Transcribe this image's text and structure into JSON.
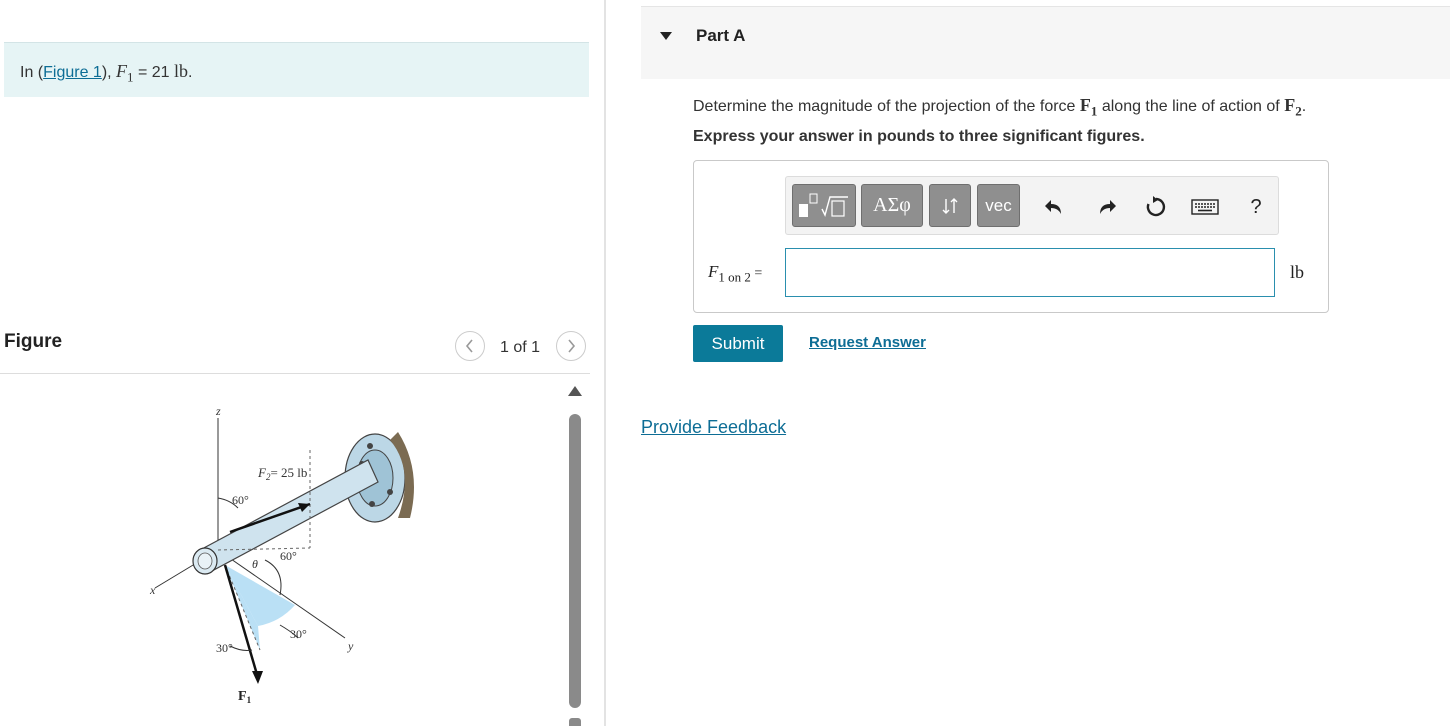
{
  "intro": {
    "prefix": "In (",
    "figure_link": "Figure 1",
    "suffix_1": "), ",
    "force_symbol": "F",
    "force_sub": "1",
    "equals": " = 21 ",
    "unit": "lb",
    "period": "."
  },
  "figure_panel": {
    "title": "Figure",
    "pager": "1 of 1",
    "labels": {
      "z": "z",
      "x": "x",
      "y": "y",
      "f2": "F",
      "f2_sub": "2",
      "f2_value": "= 25 lb",
      "angle_60a": "60°",
      "angle_60b": "60°",
      "theta": "θ",
      "angle_30a": "30°",
      "angle_30b": "30°",
      "f1": "F",
      "f1_sub": "1"
    }
  },
  "part_a": {
    "title": "Part A",
    "question_prefix": "Determine the magnitude of the projection of the force ",
    "q_f1": "F",
    "q_f1_sub": "1",
    "question_mid": " along the line of action of ",
    "q_f2": "F",
    "q_f2_sub": "2",
    "question_end": ".",
    "instruction": "Express your answer in pounds to three significant figures.",
    "toolbar": {
      "greek": "ΑΣφ",
      "vec": "vec",
      "help": "?"
    },
    "answer_label_var": "F",
    "answer_label_sub": "1 on 2",
    "answer_label_eq": " =",
    "answer_value": "",
    "unit": "lb",
    "submit": "Submit",
    "request_answer": "Request Answer"
  },
  "feedback": "Provide Feedback"
}
